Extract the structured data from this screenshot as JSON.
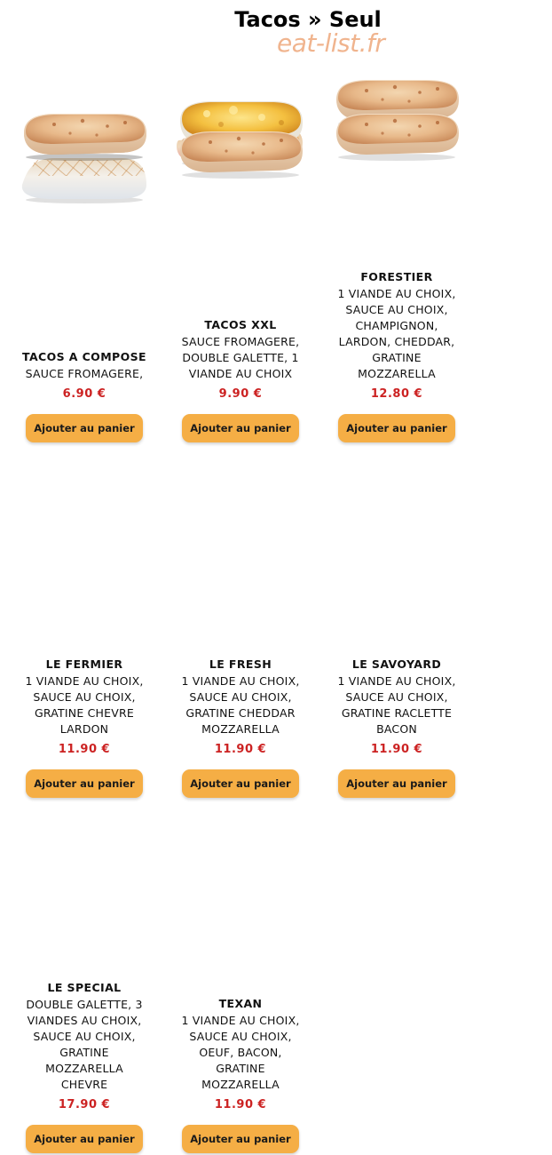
{
  "page": {
    "title": "Tacos » Seul",
    "watermark": "eat-list.fr"
  },
  "products": [
    {
      "name": "TACOS A COMPOSE",
      "description": [
        "SAUCE FROMAGERE,"
      ],
      "price": "6.90 €",
      "button": "Ajouter au panier",
      "image": "tacos-checkered-plain"
    },
    {
      "name": "TACOS XXL",
      "description": [
        "SAUCE FROMAGERE,",
        "DOUBLE GALETTE, 1",
        "VIANDE AU CHOIX"
      ],
      "price": "9.90 €",
      "button": "Ajouter au panier",
      "image": "tacos-xxl-cut"
    },
    {
      "name": "FORESTIER",
      "description": [
        "1 VIANDE AU CHOIX,",
        "SAUCE AU CHOIX,",
        "CHAMPIGNON,",
        "LARDON, CHEDDAR,",
        "GRATINE",
        "MOZZARELLA"
      ],
      "price": "12.80 €",
      "button": "Ajouter au panier",
      "image": "tacos-gratine"
    },
    {
      "name": "LE FERMIER",
      "description": [
        "1 VIANDE AU CHOIX,",
        "SAUCE AU CHOIX,",
        "GRATINE CHEVRE",
        "LARDON"
      ],
      "price": "11.90 €",
      "button": "Ajouter au panier",
      "image": "tacos-gratine"
    },
    {
      "name": "LE FRESH",
      "description": [
        "1 VIANDE AU CHOIX,",
        "SAUCE AU CHOIX,",
        "GRATINE CHEDDAR",
        "MOZZARELLA"
      ],
      "price": "11.90 €",
      "button": "Ajouter au panier",
      "image": "tacos-cheese"
    },
    {
      "name": "LE SAVOYARD",
      "description": [
        "1 VIANDE AU CHOIX,",
        "SAUCE AU CHOIX,",
        "GRATINE RACLETTE",
        "BACON"
      ],
      "price": "11.90 €",
      "button": "Ajouter au panier",
      "image": "tacos-gratine"
    },
    {
      "name": "LE SPECIAL",
      "description": [
        "DOUBLE GALETTE, 3",
        "VIANDES AU CHOIX,",
        "SAUCE AU CHOIX,",
        "GRATINE",
        "MOZZARELLA",
        "CHEVRE"
      ],
      "price": "17.90 €",
      "button": "Ajouter au panier",
      "image": "tacos-gratine"
    },
    {
      "name": "TEXAN",
      "description": [
        "1 VIANDE AU CHOIX,",
        "SAUCE AU CHOIX,",
        "OEUF, BACON,",
        "GRATINE",
        "MOZZARELLA"
      ],
      "price": "11.90 €",
      "button": "Ajouter au panier",
      "image": "tacos-gratine"
    }
  ]
}
